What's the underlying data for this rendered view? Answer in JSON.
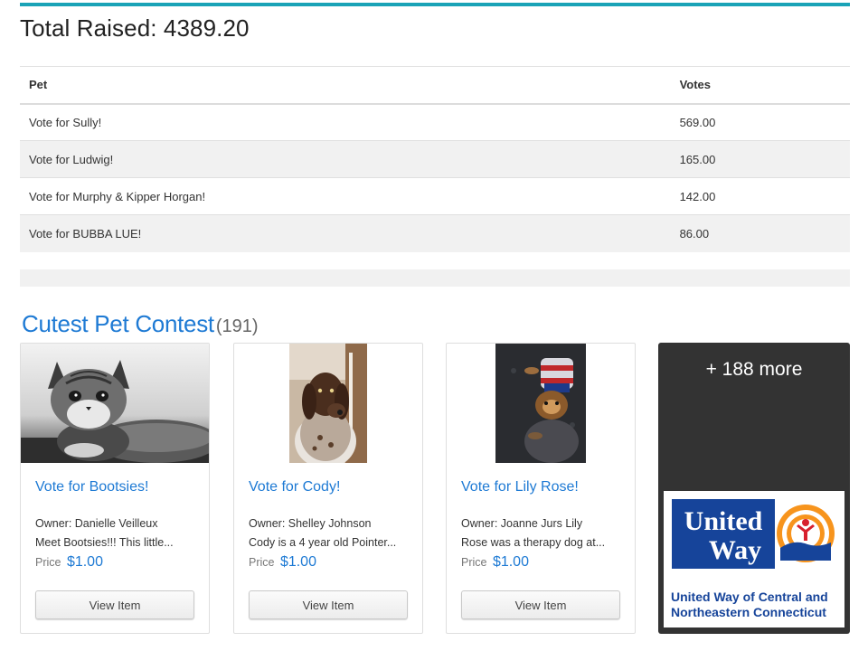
{
  "total": {
    "label": "Total Raised: 4389.20"
  },
  "leaderboard": {
    "columns": [
      "Pet",
      "Votes"
    ],
    "rows": [
      {
        "pet": "Vote for Sully!",
        "votes": "569.00"
      },
      {
        "pet": "Vote for Ludwig!",
        "votes": "165.00"
      },
      {
        "pet": "Vote for Murphy & Kipper Horgan!",
        "votes": "142.00"
      },
      {
        "pet": "Vote for BUBBA LUE!",
        "votes": "86.00"
      }
    ]
  },
  "contest": {
    "title": "Cutest Pet Contest",
    "count": "(191)"
  },
  "items": [
    {
      "title": "Vote for Bootsies!",
      "owner": "Owner: Danielle Veilleux",
      "desc": "Meet Bootsies!!! This little...",
      "price_label": "Price",
      "price": "$1.00",
      "button": "View Item"
    },
    {
      "title": "Vote for Cody!",
      "owner": "Owner: Shelley Johnson",
      "desc": "Cody is a 4 year old Pointer...",
      "price_label": "Price",
      "price": "$1.00",
      "button": "View Item"
    },
    {
      "title": "Vote for Lily Rose!",
      "owner": "Owner: Joanne Jurs Lily",
      "desc": "Rose was a therapy dog at...",
      "price_label": "Price",
      "price": "$1.00",
      "button": "View Item"
    }
  ],
  "more": {
    "label": "+ 188 more"
  },
  "sponsor": {
    "logo_line1": "United",
    "logo_line2": "Way",
    "name": "United Way of Central and Northeastern Connecticut"
  },
  "colors": {
    "accent": "#1e7ad4",
    "top_rule": "#1aa3b7",
    "more_card": "#333333",
    "united_way_blue": "#16449a",
    "united_way_orange": "#f7941d"
  }
}
